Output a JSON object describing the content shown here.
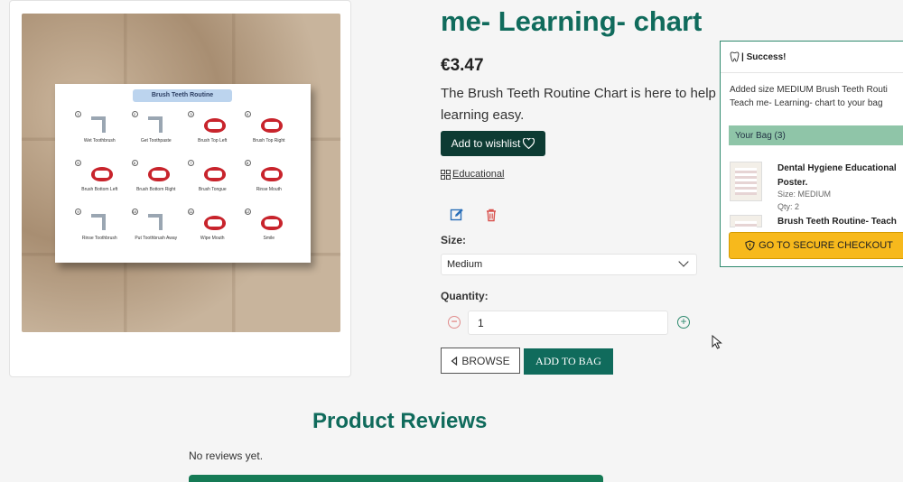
{
  "product": {
    "title": "me- Learning- chart",
    "price": "€3.47",
    "description": "The Brush Teeth Routine Chart is here to help learning easy.",
    "wishlist_label": "Add to wishlist",
    "category_label": "Educational",
    "size_label": "Size:",
    "size_selected": "Medium",
    "quantity_label": "Quantity:",
    "quantity_value": "1",
    "browse_label": "BROWSE",
    "add_to_bag_label": "ADD TO BAG"
  },
  "poster": {
    "title": "Brush Teeth Routine",
    "steps": [
      {
        "n": "1",
        "label": "Wet Toothbrush",
        "kind": "tap"
      },
      {
        "n": "2",
        "label": "Get Toothpaste",
        "kind": "tap"
      },
      {
        "n": "3",
        "label": "Brush Top Left",
        "kind": "mouth"
      },
      {
        "n": "4",
        "label": "Brush Top Right",
        "kind": "mouth"
      },
      {
        "n": "5",
        "label": "Brush Bottom Left",
        "kind": "mouth"
      },
      {
        "n": "6",
        "label": "Brush Bottom Right",
        "kind": "mouth"
      },
      {
        "n": "7",
        "label": "Brush Tongue",
        "kind": "mouth"
      },
      {
        "n": "8",
        "label": "Rinse Mouth",
        "kind": "mouth"
      },
      {
        "n": "9",
        "label": "Rinse Toothbrush",
        "kind": "tap"
      },
      {
        "n": "10",
        "label": "Put Toothbrush Away",
        "kind": "tap"
      },
      {
        "n": "11",
        "label": "Wipe Mouth",
        "kind": "mouth"
      },
      {
        "n": "12",
        "label": "Smile",
        "kind": "mouth"
      }
    ]
  },
  "reviews": {
    "title": "Product Reviews",
    "empty_text": "No reviews yet."
  },
  "toast": {
    "title": "| Success!",
    "message_line1": "Added size MEDIUM Brush Teeth Routi",
    "message_line2": "Teach me- Learning- chart to your bag",
    "bag_header": "Your Bag (3)",
    "items": [
      {
        "name": "Dental Hygiene Educational Poster.",
        "size": "Size: MEDIUM",
        "qty": "Qty: 2"
      },
      {
        "name": "Brush Teeth Routine- Teach",
        "size": "",
        "qty": ""
      }
    ],
    "checkout_label": "GO TO SECURE CHECKOUT"
  },
  "colors": {
    "brand_green": "#106b5c",
    "dark_green": "#0d3b33",
    "checkout_yellow": "#f7b91c",
    "bag_header_green": "#8fc5a8"
  }
}
